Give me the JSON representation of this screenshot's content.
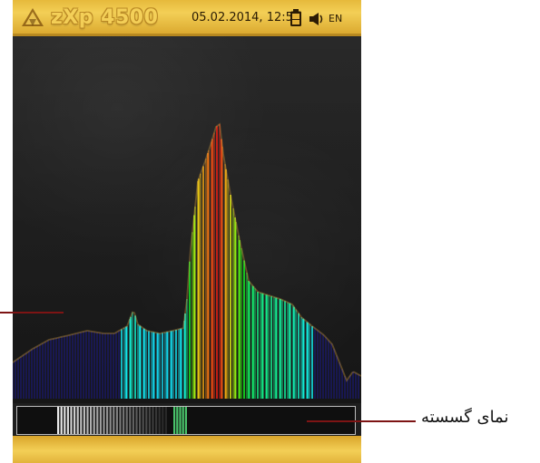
{
  "header": {
    "logo_text": "zXp 4500",
    "datetime": "05.02.2014, 12:53",
    "language": "EN",
    "icons": {
      "logo": "pyramid-logo-icon",
      "battery": "battery-icon",
      "sound": "speaker-icon"
    }
  },
  "graph": {
    "spectrum": "rainbow-vertical-lines"
  },
  "discrete_view": {
    "description": "discrete-strip"
  },
  "annotations": {
    "right_label": "نمای گسسته"
  },
  "colors": {
    "gold": "#f3cf56",
    "gold_dark": "#d9a52b",
    "background": "#222222",
    "callout": "#7d1414"
  }
}
